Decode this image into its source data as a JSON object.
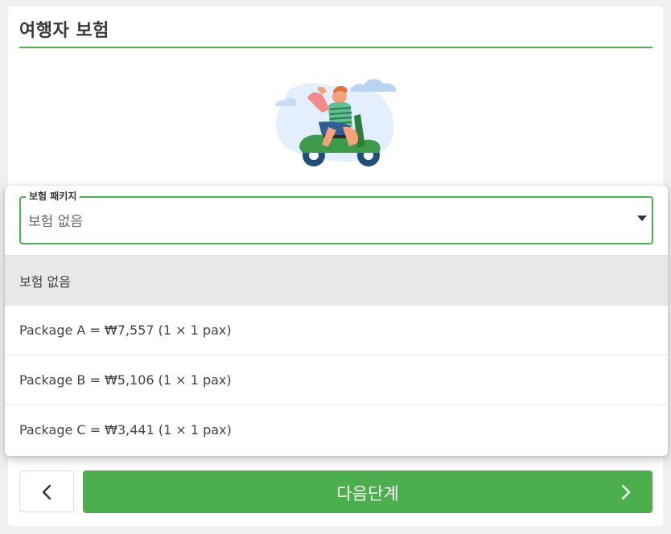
{
  "section": {
    "title": "여행자 보험"
  },
  "select": {
    "legend": "보험 패키지",
    "value": "보험 없음"
  },
  "options": [
    {
      "label": "보험 없음",
      "selected": true
    },
    {
      "label": "Package A = ₩7,557 (1 × 1 pax)",
      "selected": false
    },
    {
      "label": "Package B = ₩5,106 (1 × 1 pax)",
      "selected": false
    },
    {
      "label": "Package C = ₩3,441 (1 × 1 pax)",
      "selected": false
    }
  ],
  "footer": {
    "back_icon": "chevron-left-icon",
    "next_label": "다음단계",
    "next_icon": "chevron-right-icon"
  },
  "colors": {
    "accent": "#4caf50",
    "button": "#4cae4c",
    "selected_option": "#e8e8e8"
  },
  "illustration": {
    "subject": "person-on-scooter-illustration"
  }
}
